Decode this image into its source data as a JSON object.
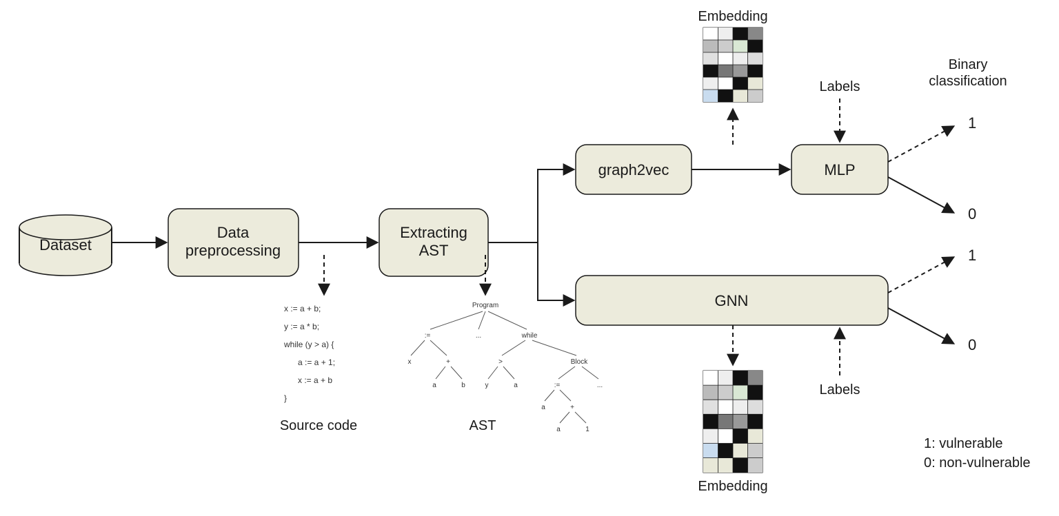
{
  "nodes": {
    "dataset": "Dataset",
    "preproc": "Data\npreprocessing",
    "extract": "Extracting\nAST",
    "g2v": "graph2vec",
    "mlp": "MLP",
    "gnn": "GNN"
  },
  "annot": {
    "embedding_top": "Embedding",
    "embedding_bottom": "Embedding",
    "labels_top": "Labels",
    "labels_bottom": "Labels",
    "binary": "Binary\nclassification",
    "one_a": "1",
    "zero_a": "0",
    "one_b": "1",
    "zero_b": "0",
    "source_code_title": "Source code",
    "ast_title": "AST",
    "legend1": "1: vulnerable",
    "legend0": "0: non-vulnerable"
  },
  "code": {
    "l1": "x := a + b;",
    "l2": "y := a * b;",
    "l3": "while (y > a) {",
    "l4": "a := a + 1;",
    "l5": "x := a + b",
    "l6": "}"
  },
  "ast": {
    "program": "Program",
    "assign": ":=",
    "dots": "...",
    "while": "while",
    "x": "x",
    "plus": "+",
    "a": "a",
    "b": "b",
    "gt": ">",
    "y": "y",
    "block": "Block",
    "one": "1"
  }
}
